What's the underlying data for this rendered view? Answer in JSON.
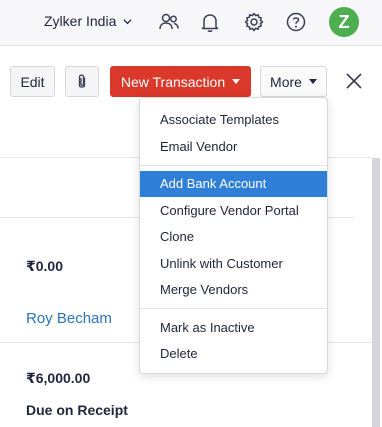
{
  "header": {
    "org_name": "Zylker India",
    "icons": [
      "users-icon",
      "bell-icon",
      "gear-icon",
      "help-icon"
    ],
    "avatar_letter": "Z",
    "avatar_color": "#4cae4f"
  },
  "toolbar": {
    "edit_label": "Edit",
    "new_transaction_label": "New Transaction",
    "more_label": "More",
    "accent_color": "#d9382b"
  },
  "more_menu": {
    "groups": [
      [
        "Associate Templates",
        "Email Vendor"
      ],
      [
        "Add Bank Account",
        "Configure Vendor Portal",
        "Clone",
        "Unlink with Customer",
        "Merge Vendors"
      ],
      [
        "Mark as Inactive",
        "Delete"
      ]
    ],
    "highlighted": "Add Bank Account",
    "highlight_color": "#2f7fd9"
  },
  "details": {
    "amount_1": "₹0.00",
    "contact_link": "Roy Becham",
    "amount_2": "₹6,000.00",
    "payment_terms": "Due on Receipt"
  }
}
